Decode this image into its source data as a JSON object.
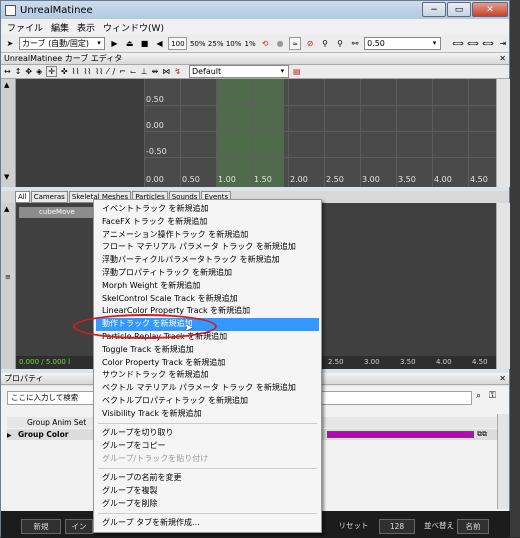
{
  "window": {
    "title": "UnrealMatinee",
    "min": "−",
    "max": "▭",
    "close": "✕"
  },
  "menubar": {
    "items": [
      "ファイル",
      "編集",
      "表示",
      "ウィンドウ(W)"
    ]
  },
  "toolbar": {
    "curve_mode": "カーブ (自動/固定)",
    "speed_buttons": [
      "100",
      "50%",
      "25%",
      "10%",
      "1%"
    ],
    "snap_value": "0.50"
  },
  "curve_editor": {
    "title": "UnrealMatinee カーブ エディタ",
    "preset": "Default",
    "y_labels": [
      "0.50",
      "0.00",
      "-0.50"
    ],
    "x_labels": [
      "0.00",
      "0.50",
      "1.00",
      "1.50",
      "2.00",
      "2.50",
      "3.00",
      "3.50",
      "4.00",
      "4.50"
    ]
  },
  "tracks": {
    "tabs": [
      "All",
      "Cameras",
      "Skeletal Meshes",
      "Particles",
      "Sounds",
      "Events"
    ],
    "group_header": "cubeMove",
    "time_readout": "0.000 / 5.000 l",
    "timeline_labels": [
      "2.50",
      "3.00",
      "3.50",
      "4.00",
      "4.50"
    ]
  },
  "context_menu": {
    "items": [
      "イベントトラック を新規追加",
      "FaceFX トラック を新規追加",
      "アニメーション操作トラック を新規追加",
      "フロート マテリアル パラメータ トラック を新規追加",
      "浮動パーティクルパラメータトラック を新規追加",
      "浮動プロパティトラック を新規追加",
      "Morph Weight を新規追加",
      "SkelControl Scale Track を新規追加",
      "LinearColor Property Track を新規追加",
      "動作トラック を新規追加",
      "Particle Replay Track を新規追加",
      "Toggle Track を新規追加",
      "Color Property Track を新規追加",
      "サウンドトラック を新規追加",
      "ベクトル マテリアル パラメータ トラック を新規追加",
      "ベクトルプロパティトラック を新規追加",
      "Visibility Track を新規追加"
    ],
    "group_items": [
      "グループを切り取り",
      "グループをコピー",
      "グループ/トラックを貼り付け"
    ],
    "manage_items": [
      "グループの名前を変更",
      "グループを複製",
      "グループを削除"
    ],
    "tab_item": "グループ タブを新規作成..."
  },
  "properties": {
    "title": "プロパティ",
    "search_placeholder": "ここに入力して検索",
    "rows": [
      "Group Anim Set",
      "Group Color"
    ]
  },
  "bottombar": {
    "new_button": "新規",
    "import_button": "イン",
    "reset_button": "リセット",
    "size_value": "128",
    "sort_label": "並べ替え",
    "sort_value": "名前"
  },
  "colors": {
    "highlight": "#3398ff",
    "annotation_circle": "#d22020",
    "group_color": "#c000c0",
    "time_green": "#76dd4f"
  }
}
